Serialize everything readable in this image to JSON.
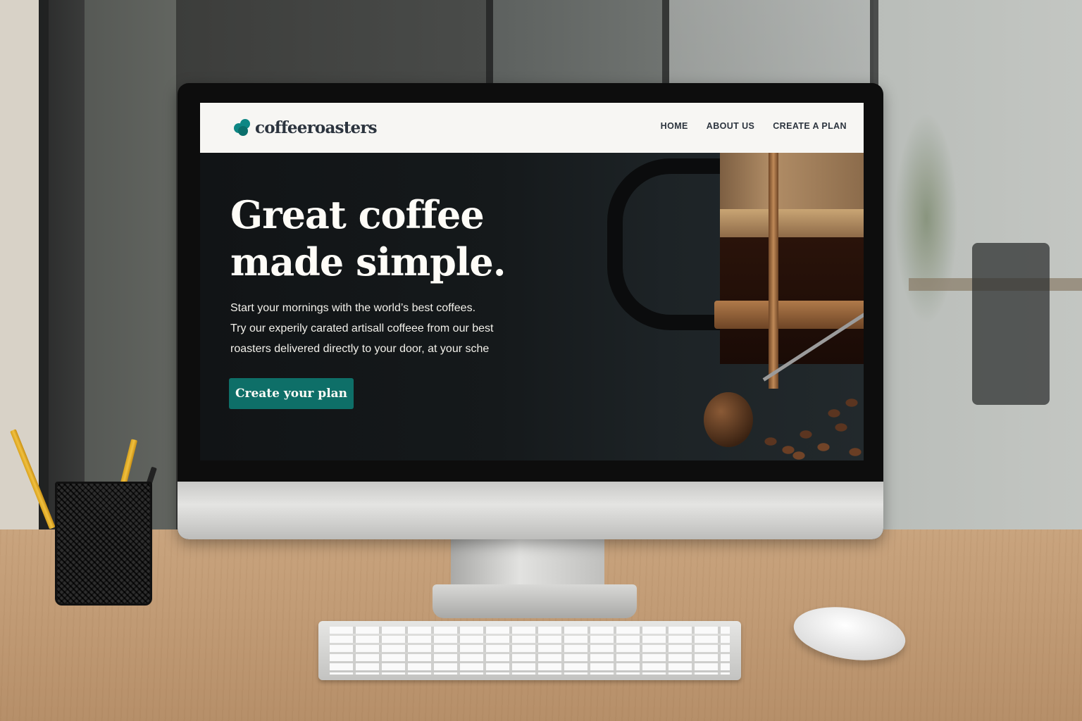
{
  "site": {
    "logo_text": "coffeeroasters",
    "nav": [
      {
        "label": "HOME"
      },
      {
        "label": "ABOUT US"
      },
      {
        "label": "CREATE A PLAN"
      }
    ]
  },
  "hero": {
    "title_line1": "Great coffee",
    "title_line2": "made simple.",
    "body_line1": "Start your mornings with the world’s best coffees.",
    "body_line2": "Try our experily carated artisall coffeee from our best",
    "body_line3": "roasters delivered directly to your door, at your sche",
    "cta_label": "Create your plan"
  },
  "colors": {
    "brand_accent": "#0e6f68",
    "logo_accent": "#0e8784",
    "text_dark": "#2c343e",
    "hero_bg": "#15191b",
    "navbar_bg": "#f7f6f3"
  },
  "icons": {
    "logo": "coffee-bean-logo-icon"
  }
}
